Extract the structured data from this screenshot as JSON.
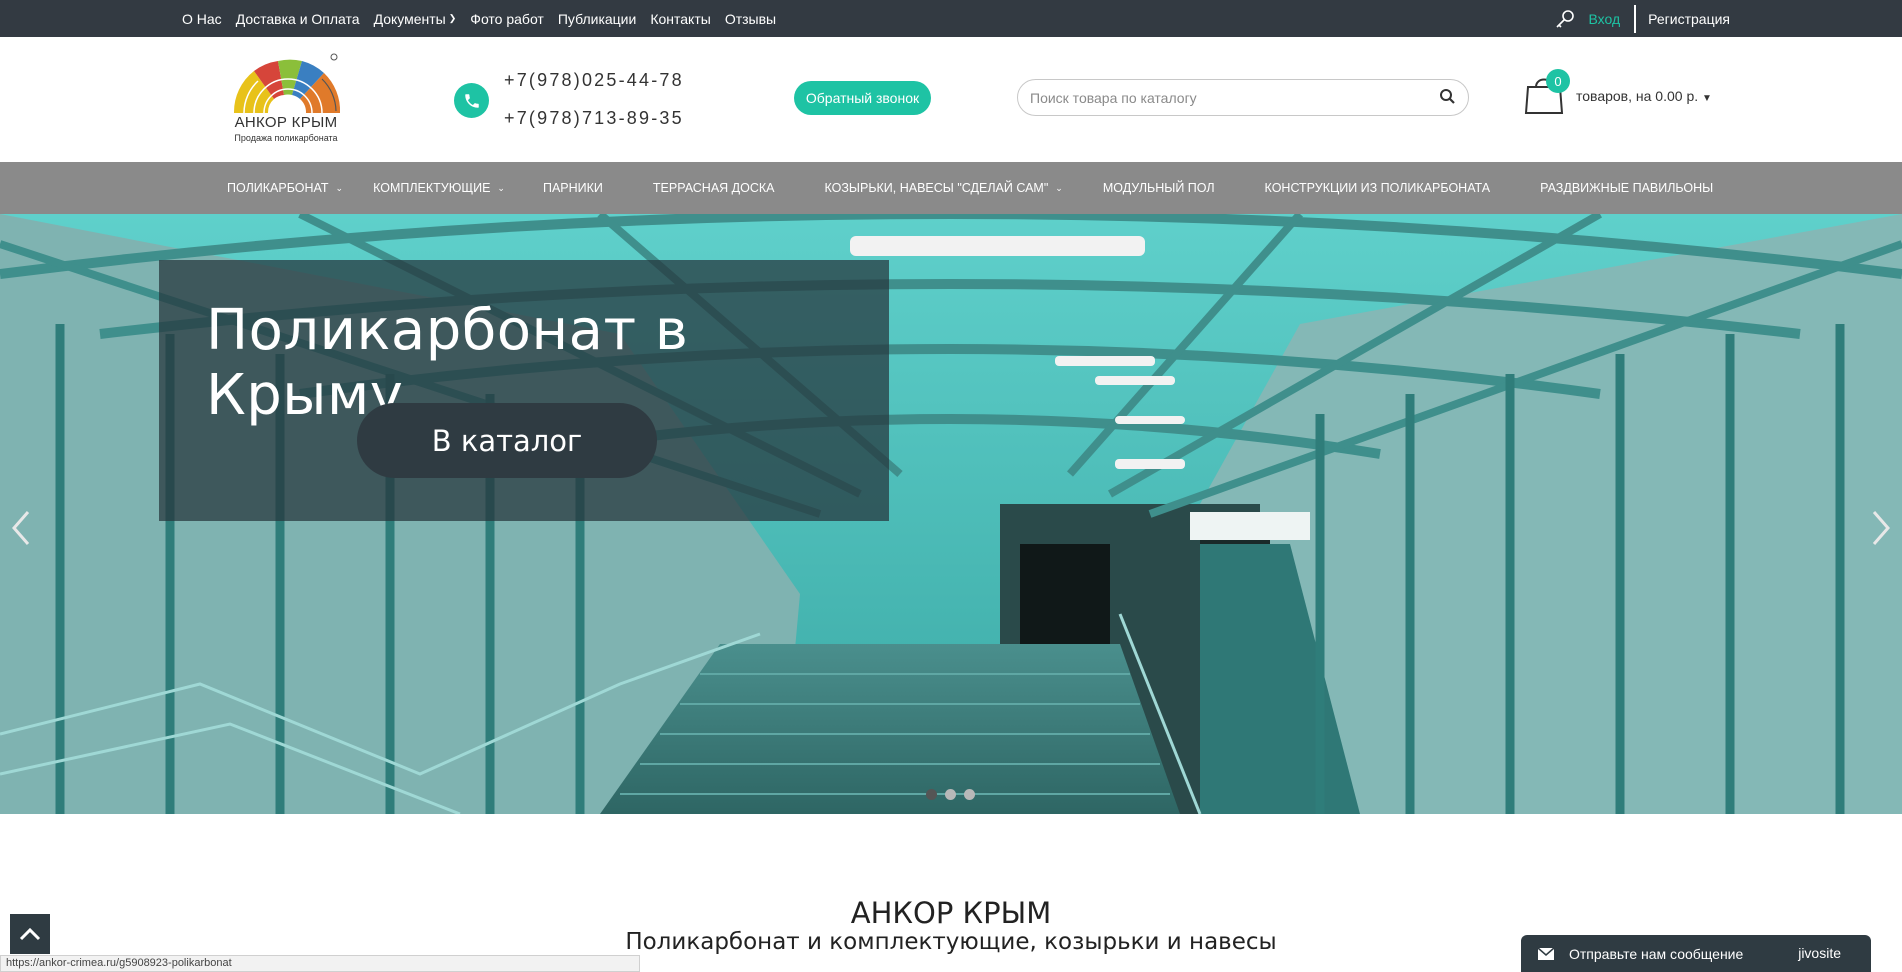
{
  "topbar": {
    "nav": [
      {
        "label": "О Нас"
      },
      {
        "label": "Доставка и Оплата"
      },
      {
        "label": "Документы"
      },
      {
        "label": "Фото работ"
      },
      {
        "label": "Публикации"
      },
      {
        "label": "Контакты"
      },
      {
        "label": "Отзывы"
      }
    ],
    "login": "Вход",
    "register": "Регистрация"
  },
  "header": {
    "logo_name": "АНКОР КРЫМ",
    "logo_tagline": "Продажа поликарбоната",
    "phone1": "+7(978)025-44-78",
    "phone2": "+7(978)713-89-35",
    "callback": "Обратный звонок",
    "search_placeholder": "Поиск товара по каталогу",
    "cart_count": "0",
    "cart_text": "товаров, на 0.00 р."
  },
  "mainnav": [
    {
      "label": "Поликарбонат",
      "dropdown": true
    },
    {
      "label": "Комплектующие",
      "dropdown": true
    },
    {
      "label": "Парники",
      "dropdown": false
    },
    {
      "label": "Террасная доска",
      "dropdown": false
    },
    {
      "label": "Козырьки, навесы \"Сделай сам\"",
      "dropdown": true
    },
    {
      "label": "Модульный пол",
      "dropdown": false
    },
    {
      "label": "Конструкции из поликарбоната",
      "dropdown": false
    },
    {
      "label": "Раздвижные павильоны",
      "dropdown": false
    }
  ],
  "hero": {
    "title": "Поликарбонат в Крыму",
    "button": "В каталог",
    "slides": 3,
    "active_slide": 1
  },
  "content": {
    "title": "АНКОР КРЫМ",
    "subtitle": "Поликарбонат и комплектующие, козырьки и навесы"
  },
  "statusbar": "https://ankor-crimea.ru/g5908923-polikarbonat",
  "chat": {
    "label": "Отправьте нам сообщение",
    "brand": "jivosite"
  },
  "colors": {
    "accent": "#1ec3a4",
    "topbar": "#333a42",
    "nav": "#8a8a8a"
  },
  "icons": [
    "key-icon",
    "phone-icon",
    "search-icon",
    "cart-icon",
    "chevron-down-icon",
    "arrow-left-icon",
    "arrow-right-icon",
    "arrow-up-icon",
    "mail-icon"
  ]
}
